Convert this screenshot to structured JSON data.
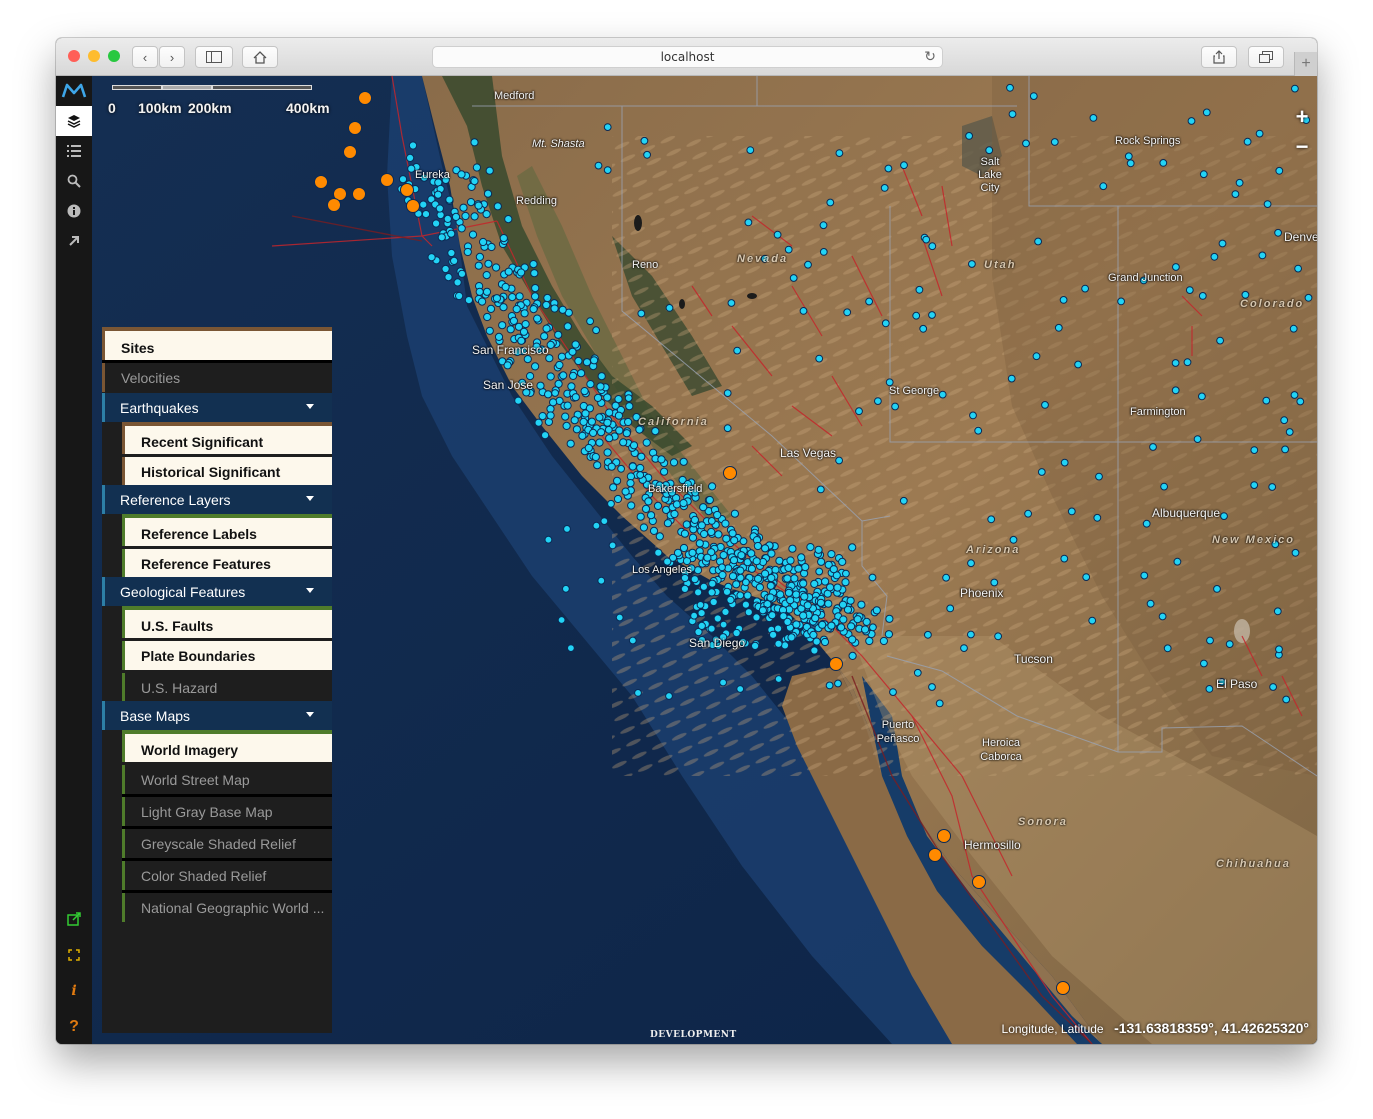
{
  "browser": {
    "url": "localhost",
    "reload_icon": "reload-icon",
    "back_icon": "chevron-left-icon",
    "forward_icon": "chevron-right-icon",
    "sidebar_icon": "sidebar-icon",
    "home_icon": "home-icon",
    "share_icon": "share-icon",
    "tabs_icon": "tabs-icon",
    "new_tab_icon": "plus-icon",
    "traffic_colors": [
      "#ff5f57",
      "#febc2e",
      "#28c840"
    ]
  },
  "sidebar": {
    "logo": "M",
    "logo_color": "#3ea6e8",
    "icons": [
      "layers-icon",
      "list-icon",
      "search-icon",
      "info-icon",
      "export-icon"
    ],
    "bottom_icons": [
      "external-link-icon",
      "fullscreen-icon",
      "info-italic-icon",
      "help-icon"
    ],
    "bottom_glyphs": [
      "⧉",
      "⛶",
      "i",
      "?"
    ]
  },
  "map": {
    "scale": {
      "labels": [
        "0",
        "100km",
        "200km",
        "400km"
      ]
    },
    "zoom": {
      "in": "+",
      "out": "−"
    },
    "coords": {
      "label": "Longitude, Latitude",
      "value": "-131.63818359°, 41.42625320°"
    },
    "dev_label": "DEVELOPMENT",
    "places": [
      {
        "name": "Medford"
      },
      {
        "name": "Mt. Shasta"
      },
      {
        "name": "Eureka"
      },
      {
        "name": "Redding"
      },
      {
        "name": "Reno"
      },
      {
        "name": "Nevada"
      },
      {
        "name": "Salt Lake City"
      },
      {
        "name": "Utah"
      },
      {
        "name": "Rock Springs"
      },
      {
        "name": "Denver"
      },
      {
        "name": "Grand Junction"
      },
      {
        "name": "Colorado"
      },
      {
        "name": "San Francisco"
      },
      {
        "name": "San Jose"
      },
      {
        "name": "California"
      },
      {
        "name": "Las Vegas"
      },
      {
        "name": "St George"
      },
      {
        "name": "Farmington"
      },
      {
        "name": "Bakersfield"
      },
      {
        "name": "Albuquerque"
      },
      {
        "name": "New Mexico"
      },
      {
        "name": "Arizona"
      },
      {
        "name": "Los Angeles"
      },
      {
        "name": "Phoenix"
      },
      {
        "name": "San Diego"
      },
      {
        "name": "Tucson"
      },
      {
        "name": "El Paso"
      },
      {
        "name": "Puerto Peñasco"
      },
      {
        "name": "Heroica Caborca"
      },
      {
        "name": "Sonora"
      },
      {
        "name": "Hermosillo"
      },
      {
        "name": "Chihuahua"
      }
    ],
    "site_color": "#22d3f5",
    "quake_color": "#ff8a00"
  },
  "layers_panel": {
    "sites": "Sites",
    "velocities": "Velocities",
    "earthquakes": {
      "label": "Earthquakes",
      "items": [
        "Recent Significant",
        "Historical Significant"
      ]
    },
    "reference": {
      "label": "Reference Layers",
      "items": [
        "Reference Labels",
        "Reference Features"
      ]
    },
    "geological": {
      "label": "Geological Features",
      "items": [
        "U.S. Faults",
        "Plate Boundaries",
        "U.S. Hazard"
      ]
    },
    "basemaps": {
      "label": "Base Maps",
      "items": [
        "World Imagery",
        "World Street Map",
        "Light Gray Base Map",
        "Greyscale Shaded Relief",
        "Color Shaded Relief",
        "National Geographic World ..."
      ]
    }
  }
}
